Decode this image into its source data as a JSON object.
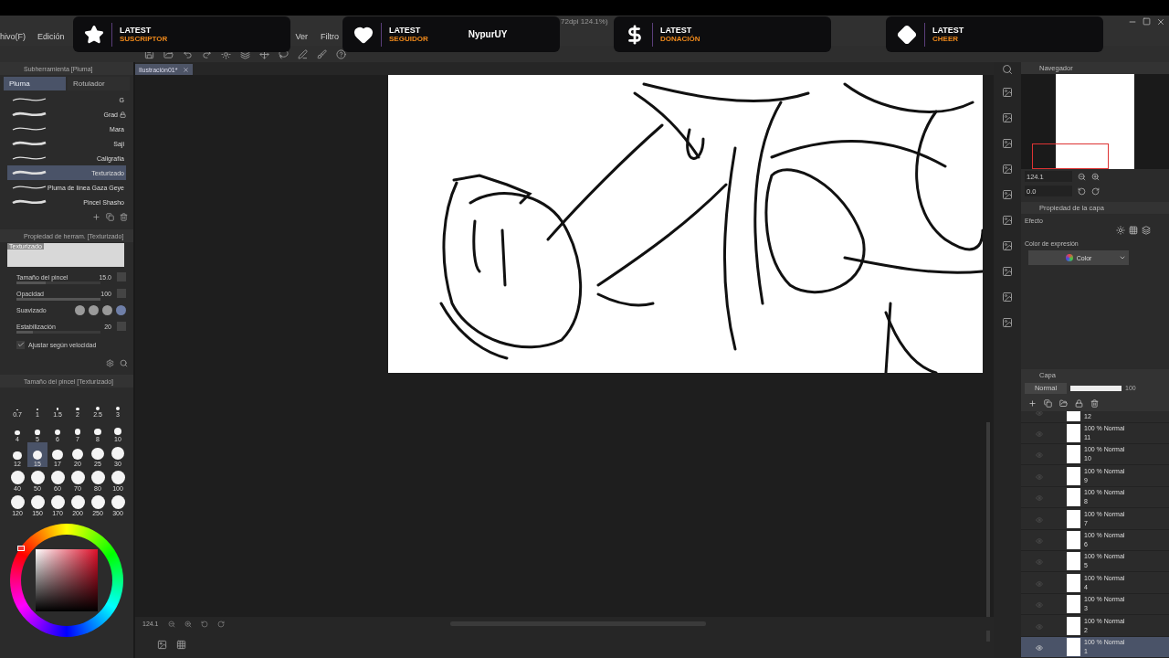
{
  "window": {
    "title": "72dpi 124.1%)"
  },
  "menu": [
    {
      "label": "hivo(F)"
    },
    {
      "label": "Edición"
    },
    {
      "label": "Ver"
    },
    {
      "label": "Filtro"
    }
  ],
  "alerts": [
    {
      "kind": "star",
      "heading": "LATEST",
      "type": "SUSCRIPTOR"
    },
    {
      "kind": "heart",
      "heading": "LATEST",
      "type": "SEGUIDOR",
      "name": "NypurUY"
    },
    {
      "kind": "dollar",
      "heading": "LATEST",
      "type": "DONACIÓN"
    },
    {
      "kind": "diamond",
      "heading": "LATEST",
      "type": "CHEER"
    }
  ],
  "document_tab": {
    "label": "Ilustración01*"
  },
  "subtool_panel": {
    "title": "Subherramienta [Pluma]",
    "tabs": [
      {
        "label": "Pluma",
        "selected": true
      },
      {
        "label": "Rotulador",
        "selected": false
      }
    ],
    "brushes": [
      {
        "name": "G",
        "selected": false,
        "locked": false
      },
      {
        "name": "Grad",
        "selected": false,
        "locked": true
      },
      {
        "name": "Mara",
        "selected": false,
        "locked": false
      },
      {
        "name": "Saji",
        "selected": false,
        "locked": false
      },
      {
        "name": "Caligrafía",
        "selected": false,
        "locked": false
      },
      {
        "name": "Texturizado",
        "selected": true,
        "locked": false
      },
      {
        "name": "Pluma de línea Gaza Geye",
        "selected": false,
        "locked": false
      },
      {
        "name": "Pincel Shasho",
        "selected": false,
        "locked": false
      }
    ]
  },
  "tool_property": {
    "title": "Propiedad de herram. [Texturizado]",
    "preview_label": "Texturizado",
    "rows": [
      {
        "kind": "slider",
        "label": "Tamaño del pincel",
        "value": "15.0",
        "level": 0.35
      },
      {
        "kind": "slider",
        "label": "Opacidad",
        "value": "100",
        "level": 1
      },
      {
        "kind": "smoothing",
        "label": "Suavizado",
        "options": [
          {
            "selected": false
          },
          {
            "selected": false
          },
          {
            "selected": false
          },
          {
            "selected": true
          }
        ]
      },
      {
        "kind": "slider",
        "label": "Estabilización",
        "value": "20",
        "level": 0.2
      }
    ],
    "checkbox": {
      "label": "Ajustar según velocidad",
      "checked": true
    }
  },
  "brush_size": {
    "title": "Tamaño del pincel [Texturizado]",
    "sizes": [
      {
        "label": "0.7",
        "selected": false
      },
      {
        "label": "1",
        "selected": false
      },
      {
        "label": "1.5",
        "selected": false
      },
      {
        "label": "2",
        "selected": false
      },
      {
        "label": "2.5",
        "selected": false
      },
      {
        "label": "3",
        "selected": false
      },
      {
        "label": "4",
        "selected": false
      },
      {
        "label": "5",
        "selected": false
      },
      {
        "label": "6",
        "selected": false
      },
      {
        "label": "7",
        "selected": false
      },
      {
        "label": "8",
        "selected": false
      },
      {
        "label": "10",
        "selected": false
      },
      {
        "label": "12",
        "selected": false
      },
      {
        "label": "15",
        "selected": true
      },
      {
        "label": "17",
        "selected": false
      },
      {
        "label": "20",
        "selected": false
      },
      {
        "label": "25",
        "selected": false
      },
      {
        "label": "30",
        "selected": false
      },
      {
        "label": "40",
        "selected": false
      },
      {
        "label": "50",
        "selected": false
      },
      {
        "label": "60",
        "selected": false
      },
      {
        "label": "70",
        "selected": false
      },
      {
        "label": "80",
        "selected": false
      },
      {
        "label": "100",
        "selected": false
      },
      {
        "label": "120",
        "selected": false
      },
      {
        "label": "150",
        "selected": false
      },
      {
        "label": "170",
        "selected": false
      },
      {
        "label": "200",
        "selected": false
      },
      {
        "label": "250",
        "selected": false
      },
      {
        "label": "300",
        "selected": false
      }
    ]
  },
  "status": {
    "zoom": "124.1"
  },
  "navigator": {
    "title": "Navegador",
    "zoom": "124.1",
    "angle": "0.0"
  },
  "layer_property": {
    "title": "Propiedad de la capa",
    "effect_label": "Efecto",
    "expression_label": "Color de expresión",
    "expression_value": "Color"
  },
  "layers": {
    "title": "Capa",
    "blend_mode": "Normal",
    "opacity": "100",
    "opacity_slider": {
      "level": 1
    },
    "items": [
      {
        "name": "12",
        "selected": false
      },
      {
        "name": "11",
        "mode": "100 % Normal",
        "selected": false
      },
      {
        "name": "10",
        "mode": "100 % Normal",
        "selected": false
      },
      {
        "name": "9",
        "mode": "100 % Normal",
        "selected": false
      },
      {
        "name": "8",
        "mode": "100 % Normal",
        "selected": false
      },
      {
        "name": "7",
        "mode": "100 % Normal",
        "selected": false
      },
      {
        "name": "6",
        "mode": "100 % Normal",
        "selected": false
      },
      {
        "name": "5",
        "mode": "100 % Normal",
        "selected": false
      },
      {
        "name": "4",
        "mode": "100 % Normal",
        "selected": false
      },
      {
        "name": "3",
        "mode": "100 % Normal",
        "selected": false
      },
      {
        "name": "2",
        "mode": "100 % Normal",
        "selected": false
      },
      {
        "name": "1",
        "mode": "100 % Normal",
        "selected": true
      }
    ]
  }
}
